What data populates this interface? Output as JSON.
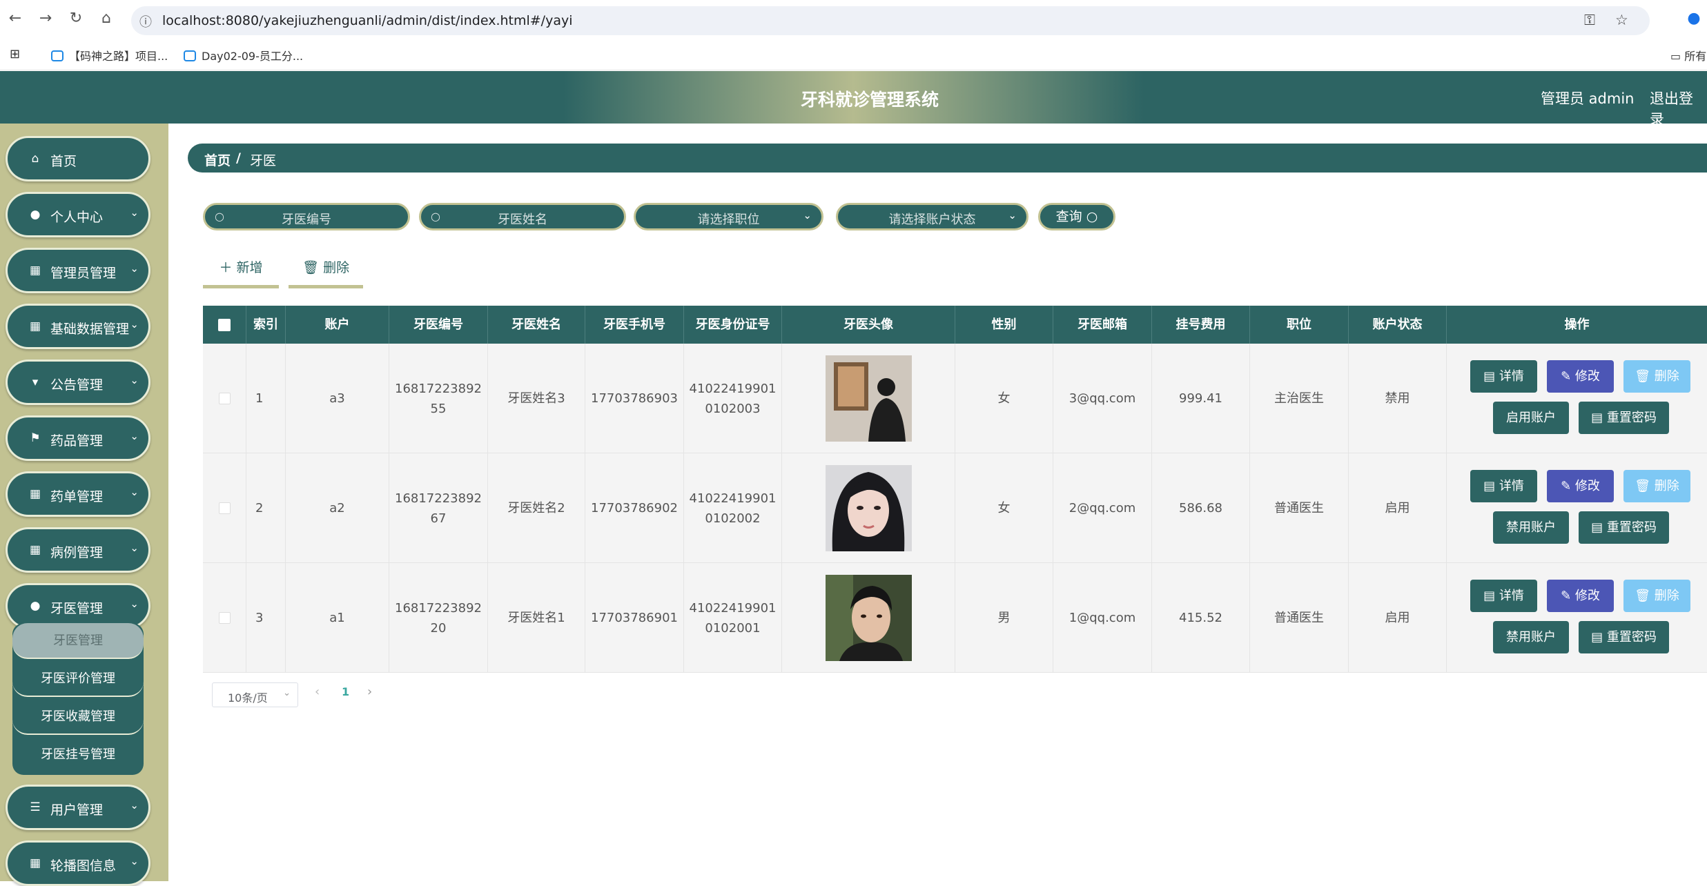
{
  "browser": {
    "url": "localhost:8080/yakejiuzhenguanli/admin/dist/index.html#/yayi",
    "bookmarks": [
      "【码神之路】项目...",
      "Day02-09-员工分..."
    ],
    "bookmark_right": "所有"
  },
  "header": {
    "title": "牙科就诊管理系统",
    "admin_label": "管理员 admin",
    "logout_label": "退出登录"
  },
  "sidebar": {
    "items": [
      {
        "label": "首页",
        "icon": "home-icon"
      },
      {
        "label": "个人中心",
        "icon": "user-icon"
      },
      {
        "label": "管理员管理",
        "icon": "grid-icon"
      },
      {
        "label": "基础数据管理",
        "icon": "grid-icon"
      },
      {
        "label": "公告管理",
        "icon": "pin-icon"
      },
      {
        "label": "药品管理",
        "icon": "flag-icon"
      },
      {
        "label": "药单管理",
        "icon": "grid-icon"
      },
      {
        "label": "病例管理",
        "icon": "grid-icon"
      },
      {
        "label": "牙医管理",
        "icon": "user-icon"
      },
      {
        "label": "用户管理",
        "icon": "sliders-icon"
      },
      {
        "label": "轮播图信息",
        "icon": "grid-icon"
      }
    ],
    "submenu": [
      "牙医管理",
      "牙医评价管理",
      "牙医收藏管理",
      "牙医挂号管理"
    ]
  },
  "breadcrumb": {
    "home": "首页",
    "separator": "/",
    "current": "牙医"
  },
  "search": {
    "code_placeholder": "牙医编号",
    "name_placeholder": "牙医姓名",
    "position_placeholder": "请选择职位",
    "status_placeholder": "请选择账户状态",
    "query_label": "查询"
  },
  "toolbar": {
    "add_label": "新增",
    "delete_label": "删除"
  },
  "table": {
    "headers": [
      "索引",
      "账户",
      "牙医编号",
      "牙医姓名",
      "牙医手机号",
      "牙医身份证号",
      "牙医头像",
      "性别",
      "牙医邮箱",
      "挂号费用",
      "职位",
      "账户状态",
      "操作"
    ],
    "rows": [
      {
        "index": "1",
        "account": "a3",
        "code_1": "16817223892",
        "code_2": "55",
        "name": "牙医姓名3",
        "phone": "17703786903",
        "id_1": "41022419901",
        "id_2": "0102003",
        "gender": "女",
        "email": "3@qq.com",
        "fee": "999.41",
        "position": "主治医生",
        "status": "禁用",
        "toggle_label": "启用账户"
      },
      {
        "index": "2",
        "account": "a2",
        "code_1": "16817223892",
        "code_2": "67",
        "name": "牙医姓名2",
        "phone": "17703786902",
        "id_1": "41022419901",
        "id_2": "0102002",
        "gender": "女",
        "email": "2@qq.com",
        "fee": "586.68",
        "position": "普通医生",
        "status": "启用",
        "toggle_label": "禁用账户"
      },
      {
        "index": "3",
        "account": "a1",
        "code_1": "16817223892",
        "code_2": "20",
        "name": "牙医姓名1",
        "phone": "17703786901",
        "id_1": "41022419901",
        "id_2": "0102001",
        "gender": "男",
        "email": "1@qq.com",
        "fee": "415.52",
        "position": "普通医生",
        "status": "启用",
        "toggle_label": "禁用账户"
      }
    ],
    "actions": {
      "detail": "详情",
      "edit": "修改",
      "delete": "删除",
      "reset": "重置密码"
    }
  },
  "pagination": {
    "page_size": "10条/页",
    "current_page": "1"
  },
  "colors": {
    "primary": "#2d6463",
    "sidebar_bg": "#c2c292",
    "edit": "#4c56b5",
    "delete": "#7ec8f4",
    "pager_active": "#3aa8a0"
  }
}
